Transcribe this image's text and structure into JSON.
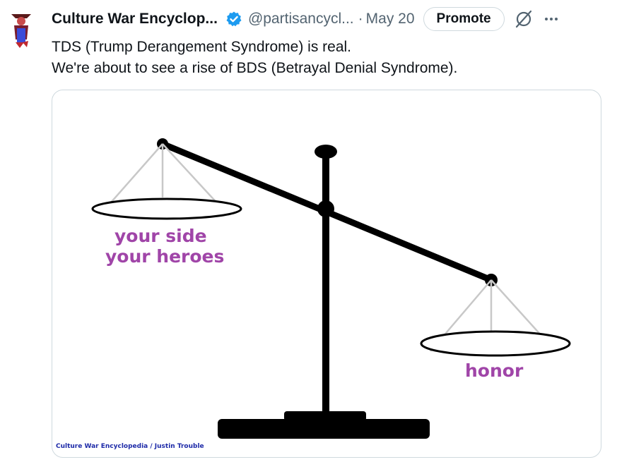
{
  "tweet": {
    "author_name": "Culture War Encyclop...",
    "handle": "@partisancycl...",
    "separator": "·",
    "date": "May 20",
    "promote_label": "Promote",
    "text_lines": [
      "TDS (Trump Derangement Syndrome) is real.",
      "We're about to see a rise of BDS (Betrayal Denial Syndrome)."
    ],
    "verified_color": "#1d9bf0",
    "icons": [
      "avatar",
      "verified-badge-icon",
      "grok-icon",
      "more-icon"
    ]
  },
  "image": {
    "left_pan_line1": "your side",
    "left_pan_line2": "your heroes",
    "right_pan_label": "honor",
    "credit": "Culture War Encyclopedia / Justin Trouble",
    "label_color": "#a045a8",
    "credit_color": "#1d2aa8"
  }
}
